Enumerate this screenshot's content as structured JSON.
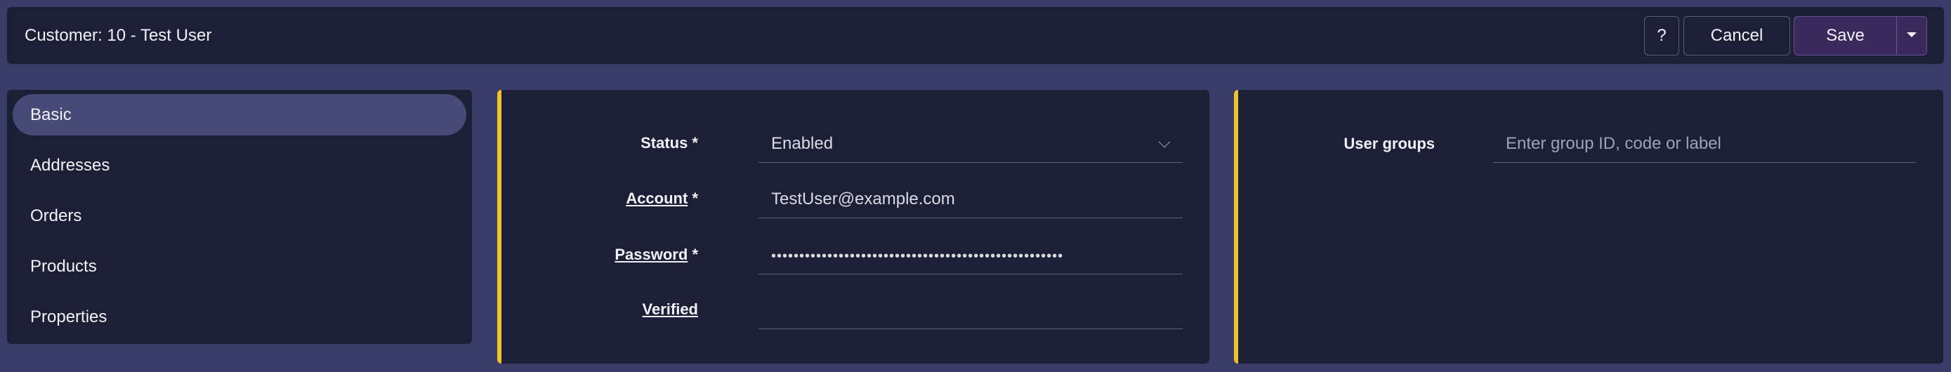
{
  "header": {
    "title": "Customer: 10 - Test User",
    "help_label": "?",
    "cancel_label": "Cancel",
    "save_label": "Save"
  },
  "sidebar": {
    "items": [
      {
        "label": "Basic",
        "active": true
      },
      {
        "label": "Addresses"
      },
      {
        "label": "Orders"
      },
      {
        "label": "Products"
      },
      {
        "label": "Properties"
      }
    ]
  },
  "form": {
    "status_label": "Status *",
    "status_value": "Enabled",
    "account_label": "Account",
    "account_value": "TestUser@example.com",
    "password_label": "Password",
    "password_value": "••••••••••••••••••••••••••••••••••••••••••••••••••••",
    "verified_label": "Verified",
    "required_mark": "*"
  },
  "groups": {
    "label": "User groups",
    "placeholder": "Enter group ID, code or label"
  },
  "colors": {
    "background": "#3a3c68",
    "panel": "#1c2036",
    "accent": "#f2c12e",
    "active_item": "#454a76",
    "save_button": "#3a2a5c"
  }
}
